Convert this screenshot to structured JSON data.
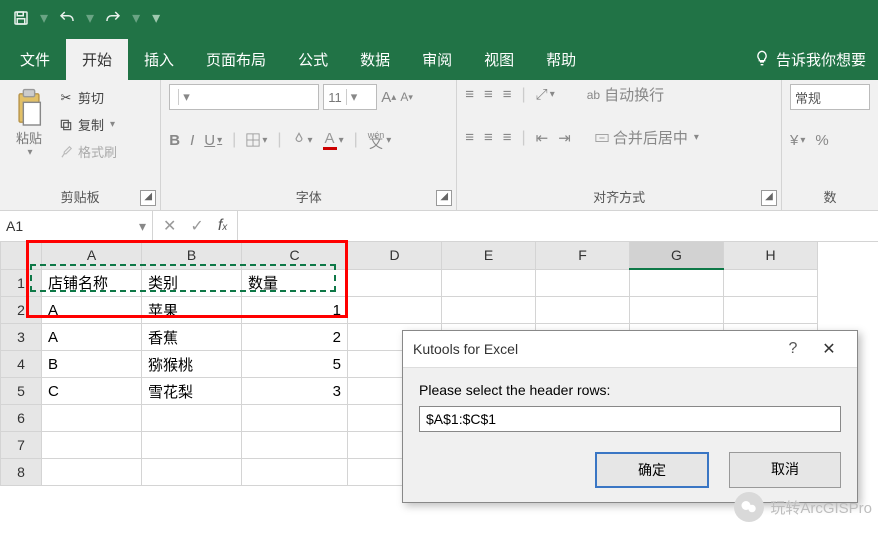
{
  "qat": {
    "save": "save-icon",
    "undo": "undo-icon",
    "redo": "redo-icon"
  },
  "tabs": {
    "file": "文件",
    "home": "开始",
    "insert": "插入",
    "layout": "页面布局",
    "formulas": "公式",
    "data": "数据",
    "review": "审阅",
    "view": "视图",
    "help": "帮助",
    "tell_me": "告诉我你想要"
  },
  "ribbon": {
    "clipboard": {
      "paste": "粘贴",
      "cut": "剪切",
      "copy": "复制",
      "format_painter": "格式刷",
      "group": "剪贴板"
    },
    "font": {
      "font_name": "",
      "font_size": "11",
      "group": "字体",
      "wen": "wén"
    },
    "alignment": {
      "wrap": "自动换行",
      "merge": "合并后居中",
      "group": "对齐方式"
    },
    "number": {
      "format": "常规",
      "group": "数"
    }
  },
  "namebox": "A1",
  "formula": "",
  "columns": [
    "A",
    "B",
    "C",
    "D",
    "E",
    "F",
    "G",
    "H"
  ],
  "rows": [
    {
      "n": "1",
      "A": "店铺名称",
      "B": "类别",
      "C": "数量"
    },
    {
      "n": "2",
      "A": "A",
      "B": "苹果",
      "C": "1"
    },
    {
      "n": "3",
      "A": "A",
      "B": "香蕉",
      "C": "2"
    },
    {
      "n": "4",
      "A": "B",
      "B": "猕猴桃",
      "C": "5"
    },
    {
      "n": "5",
      "A": "C",
      "B": "雪花梨",
      "C": "3"
    },
    {
      "n": "6"
    },
    {
      "n": "7"
    },
    {
      "n": "8"
    }
  ],
  "dialog": {
    "title": "Kutools for Excel",
    "prompt": "Please select the header rows:",
    "value": "$A$1:$C$1",
    "ok": "确定",
    "cancel": "取消"
  },
  "watermark": "玩转ArcGISPro",
  "chart_data": {
    "type": "table",
    "columns": [
      "店铺名称",
      "类别",
      "数量"
    ],
    "rows": [
      [
        "A",
        "苹果",
        1
      ],
      [
        "A",
        "香蕉",
        2
      ],
      [
        "B",
        "猕猴桃",
        5
      ],
      [
        "C",
        "雪花梨",
        3
      ]
    ]
  }
}
